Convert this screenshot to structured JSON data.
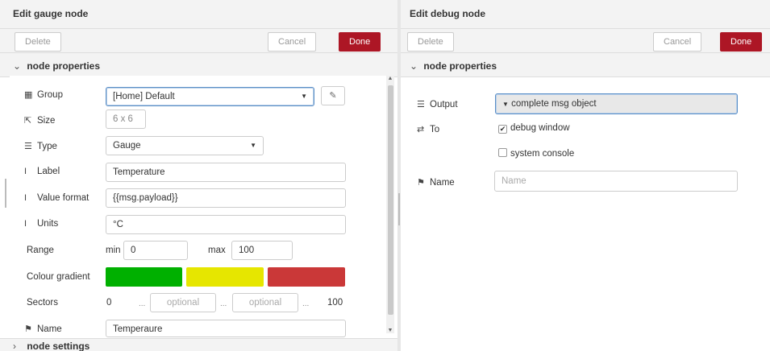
{
  "gauge": {
    "title": "Edit gauge node",
    "delete_label": "Delete",
    "cancel_label": "Cancel",
    "done_label": "Done",
    "section_label": "node properties",
    "settings_label": "node settings",
    "group": {
      "label": "Group",
      "value": "[Home] Default"
    },
    "size": {
      "label": "Size",
      "value": "6 x 6"
    },
    "type": {
      "label": "Type",
      "value": "Gauge"
    },
    "label_field": {
      "label": "Label",
      "value": "Temperature"
    },
    "value_format": {
      "label": "Value format",
      "value": "{{msg.payload}}"
    },
    "units": {
      "label": "Units",
      "value": "°C"
    },
    "range": {
      "label": "Range",
      "min_label": "min",
      "min_value": "0",
      "max_label": "max",
      "max_value": "100"
    },
    "colour_gradient": {
      "label": "Colour gradient",
      "colors": [
        "#00b000",
        "#e6e600",
        "#ca3838"
      ]
    },
    "sectors": {
      "label": "Sectors",
      "start": "0",
      "optional1": "optional",
      "optional2": "optional",
      "end": "100",
      "ellipsis": "..."
    },
    "name": {
      "label": "Name",
      "value": "Temperaure"
    }
  },
  "debug": {
    "title": "Edit debug node",
    "delete_label": "Delete",
    "cancel_label": "Cancel",
    "done_label": "Done",
    "section_label": "node properties",
    "output": {
      "label": "Output",
      "value": "complete msg object"
    },
    "to": {
      "label": "To",
      "debug_window": "debug window",
      "system_console": "system console"
    },
    "name": {
      "label": "Name",
      "placeholder": "Name"
    }
  },
  "colors": {
    "done": "#ad1625",
    "focus": "#5b8fc7"
  },
  "icons": [
    "table-icon",
    "resize-icon",
    "list-icon",
    "text-cursor-icon",
    "tag-icon",
    "shuffle-icon",
    "pencil-icon",
    "chevron-down-icon",
    "chevron-right-icon"
  ]
}
